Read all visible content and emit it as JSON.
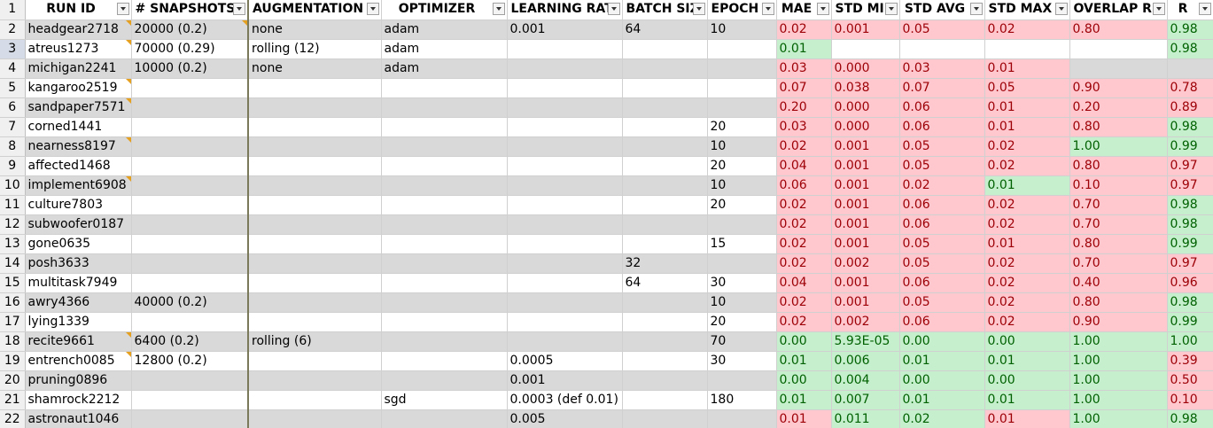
{
  "headers": [
    "RUN ID",
    "# SNAPSHOTS",
    "AUGMENTATION",
    "OPTIMIZER",
    "LEARNING RAT",
    "BATCH SIZ",
    "EPOCH",
    "MAE",
    "STD MI",
    "STD AVG",
    "STD MAX",
    "OVERLAP R",
    "R"
  ],
  "rows": [
    {
      "num": "2",
      "selected": false,
      "cells": [
        "headgear2718",
        "20000 (0.2)",
        "none",
        "adam",
        "0.001",
        "64",
        "10",
        "0.02",
        "0.001",
        "0.05",
        "0.02",
        "0.80",
        "0.98"
      ],
      "colors": [
        "",
        "",
        "",
        "",
        "",
        "",
        "",
        "red",
        "red",
        "red",
        "red",
        "red",
        "green"
      ],
      "notes": [
        0,
        1
      ]
    },
    {
      "num": "3",
      "selected": true,
      "cells": [
        "atreus1273",
        "70000 (0.29)",
        "rolling (12)",
        "adam",
        "",
        "",
        "",
        "0.01",
        "",
        "",
        "",
        "",
        "0.98"
      ],
      "colors": [
        "",
        "",
        "",
        "",
        "",
        "",
        "",
        "green",
        "",
        "",
        "",
        "",
        "green"
      ],
      "notes": [
        0
      ]
    },
    {
      "num": "4",
      "selected": false,
      "cells": [
        "michigan2241",
        "10000 (0.2)",
        "none",
        "adam",
        "",
        "",
        "",
        "0.03",
        "0.000",
        "0.03",
        "0.01",
        "",
        ""
      ],
      "colors": [
        "",
        "",
        "",
        "",
        "",
        "",
        "",
        "red",
        "red",
        "red",
        "red",
        "",
        ""
      ],
      "notes": []
    },
    {
      "num": "5",
      "selected": false,
      "cells": [
        "kangaroo2519",
        "",
        "",
        "",
        "",
        "",
        "",
        "0.07",
        "0.038",
        "0.07",
        "0.05",
        "0.90",
        "0.78"
      ],
      "colors": [
        "",
        "",
        "",
        "",
        "",
        "",
        "",
        "red",
        "red",
        "red",
        "red",
        "red",
        "red"
      ],
      "notes": [
        0
      ]
    },
    {
      "num": "6",
      "selected": false,
      "cells": [
        "sandpaper7571",
        "",
        "",
        "",
        "",
        "",
        "",
        "0.20",
        "0.000",
        "0.06",
        "0.01",
        "0.20",
        "0.89"
      ],
      "colors": [
        "",
        "",
        "",
        "",
        "",
        "",
        "",
        "red",
        "red",
        "red",
        "red",
        "red",
        "red"
      ],
      "notes": [
        0
      ]
    },
    {
      "num": "7",
      "selected": false,
      "cells": [
        "corned1441",
        "",
        "",
        "",
        "",
        "",
        "20",
        "0.03",
        "0.000",
        "0.06",
        "0.01",
        "0.80",
        "0.98"
      ],
      "colors": [
        "",
        "",
        "",
        "",
        "",
        "",
        "",
        "red",
        "red",
        "red",
        "red",
        "red",
        "green"
      ],
      "notes": []
    },
    {
      "num": "8",
      "selected": false,
      "cells": [
        "nearness8197",
        "",
        "",
        "",
        "",
        "",
        "10",
        "0.02",
        "0.001",
        "0.05",
        "0.02",
        "1.00",
        "0.99"
      ],
      "colors": [
        "",
        "",
        "",
        "",
        "",
        "",
        "",
        "red",
        "red",
        "red",
        "red",
        "green",
        "green"
      ],
      "notes": [
        0
      ]
    },
    {
      "num": "9",
      "selected": false,
      "cells": [
        "affected1468",
        "",
        "",
        "",
        "",
        "",
        "20",
        "0.04",
        "0.001",
        "0.05",
        "0.02",
        "0.80",
        "0.97"
      ],
      "colors": [
        "",
        "",
        "",
        "",
        "",
        "",
        "",
        "red",
        "red",
        "red",
        "red",
        "red",
        "red"
      ],
      "notes": []
    },
    {
      "num": "10",
      "selected": false,
      "cells": [
        "implement6908",
        "",
        "",
        "",
        "",
        "",
        "10",
        "0.06",
        "0.001",
        "0.02",
        "0.01",
        "0.10",
        "0.97"
      ],
      "colors": [
        "",
        "",
        "",
        "",
        "",
        "",
        "",
        "red",
        "red",
        "red",
        "green",
        "red",
        "red"
      ],
      "notes": [
        0
      ]
    },
    {
      "num": "11",
      "selected": false,
      "cells": [
        "culture7803",
        "",
        "",
        "",
        "",
        "",
        "20",
        "0.02",
        "0.001",
        "0.06",
        "0.02",
        "0.70",
        "0.98"
      ],
      "colors": [
        "",
        "",
        "",
        "",
        "",
        "",
        "",
        "red",
        "red",
        "red",
        "red",
        "red",
        "green"
      ],
      "notes": []
    },
    {
      "num": "12",
      "selected": false,
      "cells": [
        "subwoofer0187",
        "",
        "",
        "",
        "",
        "",
        "",
        "0.02",
        "0.001",
        "0.06",
        "0.02",
        "0.70",
        "0.98"
      ],
      "colors": [
        "",
        "",
        "",
        "",
        "",
        "",
        "",
        "red",
        "red",
        "red",
        "red",
        "red",
        "green"
      ],
      "notes": []
    },
    {
      "num": "13",
      "selected": false,
      "cells": [
        "gone0635",
        "",
        "",
        "",
        "",
        "",
        "15",
        "0.02",
        "0.001",
        "0.05",
        "0.01",
        "0.80",
        "0.99"
      ],
      "colors": [
        "",
        "",
        "",
        "",
        "",
        "",
        "",
        "red",
        "red",
        "red",
        "red",
        "red",
        "green"
      ],
      "notes": []
    },
    {
      "num": "14",
      "selected": false,
      "cells": [
        "posh3633",
        "",
        "",
        "",
        "",
        "32",
        "",
        "0.02",
        "0.002",
        "0.05",
        "0.02",
        "0.70",
        "0.97"
      ],
      "colors": [
        "",
        "",
        "",
        "",
        "",
        "",
        "",
        "red",
        "red",
        "red",
        "red",
        "red",
        "red"
      ],
      "notes": []
    },
    {
      "num": "15",
      "selected": false,
      "cells": [
        "multitask7949",
        "",
        "",
        "",
        "",
        "64",
        "30",
        "0.04",
        "0.001",
        "0.06",
        "0.02",
        "0.40",
        "0.96"
      ],
      "colors": [
        "",
        "",
        "",
        "",
        "",
        "",
        "",
        "red",
        "red",
        "red",
        "red",
        "red",
        "red"
      ],
      "notes": []
    },
    {
      "num": "16",
      "selected": false,
      "cells": [
        "awry4366",
        "40000 (0.2)",
        "",
        "",
        "",
        "",
        "10",
        "0.02",
        "0.001",
        "0.05",
        "0.02",
        "0.80",
        "0.98"
      ],
      "colors": [
        "",
        "",
        "",
        "",
        "",
        "",
        "",
        "red",
        "red",
        "red",
        "red",
        "red",
        "green"
      ],
      "notes": []
    },
    {
      "num": "17",
      "selected": false,
      "cells": [
        "lying1339",
        "",
        "",
        "",
        "",
        "",
        "20",
        "0.02",
        "0.002",
        "0.06",
        "0.02",
        "0.90",
        "0.99"
      ],
      "colors": [
        "",
        "",
        "",
        "",
        "",
        "",
        "",
        "red",
        "red",
        "red",
        "red",
        "red",
        "green"
      ],
      "notes": []
    },
    {
      "num": "18",
      "selected": false,
      "cells": [
        "recite9661",
        "6400 (0.2)",
        "rolling (6)",
        "",
        "",
        "",
        "70",
        "0.00",
        "5.93E-05",
        "0.00",
        "0.00",
        "1.00",
        "1.00"
      ],
      "colors": [
        "",
        "",
        "",
        "",
        "",
        "",
        "",
        "green",
        "green",
        "green",
        "green",
        "green",
        "green"
      ],
      "notes": [
        0
      ]
    },
    {
      "num": "19",
      "selected": false,
      "cells": [
        "entrench0085",
        "12800 (0.2)",
        "",
        "",
        "0.0005",
        "",
        "30",
        "0.01",
        "0.006",
        "0.01",
        "0.01",
        "1.00",
        "0.39"
      ],
      "colors": [
        "",
        "",
        "",
        "",
        "",
        "",
        "",
        "green",
        "green",
        "green",
        "green",
        "green",
        "red"
      ],
      "notes": [
        0
      ]
    },
    {
      "num": "20",
      "selected": false,
      "cells": [
        "pruning0896",
        "",
        "",
        "",
        "0.001",
        "",
        "",
        "0.00",
        "0.004",
        "0.00",
        "0.00",
        "1.00",
        "0.50"
      ],
      "colors": [
        "",
        "",
        "",
        "",
        "",
        "",
        "",
        "green",
        "green",
        "green",
        "green",
        "green",
        "red"
      ],
      "notes": []
    },
    {
      "num": "21",
      "selected": false,
      "cells": [
        "shamrock2212",
        "",
        "",
        "sgd",
        "0.0003 (def 0.01)",
        "",
        "180",
        "0.01",
        "0.007",
        "0.01",
        "0.01",
        "1.00",
        "0.10"
      ],
      "colors": [
        "",
        "",
        "",
        "",
        "",
        "",
        "",
        "green",
        "green",
        "green",
        "green",
        "green",
        "red"
      ],
      "notes": []
    },
    {
      "num": "22",
      "selected": false,
      "cells": [
        "astronaut1046",
        "",
        "",
        "",
        "0.005",
        "",
        "",
        "0.01",
        "0.011",
        "0.02",
        "0.01",
        "1.00",
        "0.98"
      ],
      "colors": [
        "",
        "",
        "",
        "",
        "",
        "",
        "",
        "red",
        "green",
        "green",
        "red",
        "green",
        "green"
      ],
      "notes": []
    }
  ]
}
